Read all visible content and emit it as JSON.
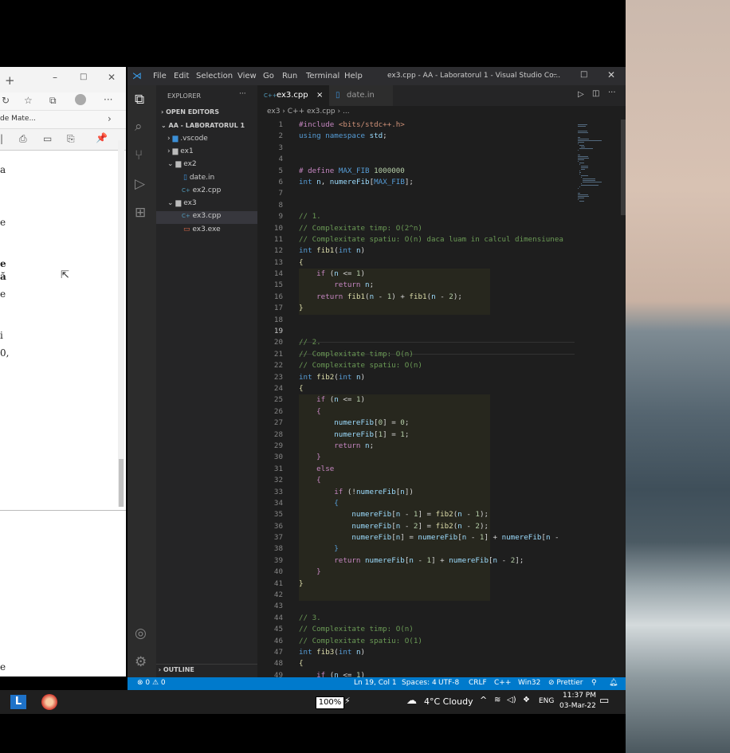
{
  "browser": {
    "tab_label": "de Mate...",
    "body_letters": [
      "a",
      "e",
      "e",
      "ă",
      "e",
      "i",
      "0,",
      "e"
    ]
  },
  "vscode": {
    "menu": [
      "File",
      "Edit",
      "Selection",
      "View",
      "Go",
      "Run",
      "Terminal",
      "Help"
    ],
    "title": "ex3.cpp - AA - Laboratorul 1 - Visual Studio Co...",
    "explorer_label": "EXPLORER",
    "open_editors": "OPEN EDITORS",
    "project": "AA - LABORATORUL 1",
    "tree": [
      {
        "label": ".vscode",
        "icon": "folder-icon"
      },
      {
        "label": "ex1",
        "icon": "folder-icon"
      },
      {
        "label": "ex2",
        "icon": "folder-open-icon"
      },
      {
        "label": "date.in",
        "icon": "file-icon"
      },
      {
        "label": "ex2.cpp",
        "icon": "cpp-file-icon"
      },
      {
        "label": "ex3",
        "icon": "folder-open-icon"
      },
      {
        "label": "ex3.cpp",
        "icon": "cpp-file-icon"
      },
      {
        "label": "ex3.exe",
        "icon": "exe-file-icon"
      }
    ],
    "outline_label": "OUTLINE",
    "tabs": [
      {
        "label": "ex3.cpp",
        "prefix": "C++",
        "close": "×"
      },
      {
        "label": "date.in"
      }
    ],
    "breadcrumb": "ex3 › C++ ex3.cpp › ...",
    "status": {
      "left": "⊗ 0 ⚠ 0",
      "position": "Ln 19, Col 1",
      "spaces": "Spaces: 4",
      "encoding": "UTF-8",
      "eol": "CRLF",
      "lang": "C++",
      "platform": "Win32",
      "prettier": "⊘ Prettier"
    },
    "current_line": 19,
    "code": [
      "<span class=\"pp\">#include</span> <span class=\"st2\">&lt;bits/stdc++.h&gt;</span>",
      "<span class=\"kw\">using</span> <span class=\"kw\">namespace</span> <span class=\"vr\">std</span>;",
      "",
      "",
      "<span class=\"pp\"># define</span> <span class=\"mac\">MAX_FIB</span> <span class=\"nu\">1000000</span>",
      "<span class=\"ty\">int</span> <span class=\"vr\">n</span>, <span class=\"vr\">numereFib</span>[<span class=\"mac\">MAX_FIB</span>];",
      "",
      "",
      "<span class=\"cm\">// 1.</span>",
      "<span class=\"cm\">// Complexitate timp: O(2^n)</span>",
      "<span class=\"cm\">// Complexitate spatiu: O(n) daca luam in calcul dimensiunea</span>",
      "<span class=\"ty\">int</span> <span class=\"fn\">fib1</span>(<span class=\"ty\">int</span> <span class=\"vr\">n</span>)",
      "<span class=\"fn\">{</span>",
      "    <span class=\"ctl\">if</span> (<span class=\"vr\">n</span> &lt;= <span class=\"nu\">1</span>)",
      "        <span class=\"ctl\">return</span> <span class=\"vr\">n</span>;",
      "    <span class=\"ctl\">return</span> <span class=\"fn\">fib1</span>(<span class=\"vr\">n</span> - <span class=\"nu\">1</span>) + <span class=\"fn\">fib1</span>(<span class=\"vr\">n</span> - <span class=\"nu\">2</span>);",
      "<span class=\"fn\">}</span>",
      "",
      "",
      "<span class=\"cm\">// 2.</span>",
      "<span class=\"cm\">// Complexitate timp: O(n)</span>",
      "<span class=\"cm\">// Complexitate spatiu: O(n)</span>",
      "<span class=\"ty\">int</span> <span class=\"fn\">fib2</span>(<span class=\"ty\">int</span> <span class=\"vr\">n</span>)",
      "<span class=\"fn\">{</span>",
      "    <span class=\"ctl\">if</span> (<span class=\"vr\">n</span> &lt;= <span class=\"nu\">1</span>)",
      "    <span class=\"ctl\">{</span>",
      "        <span class=\"vr\">numereFib</span>[<span class=\"nu\">0</span>] = <span class=\"nu\">0</span>;",
      "        <span class=\"vr\">numereFib</span>[<span class=\"nu\">1</span>] = <span class=\"nu\">1</span>;",
      "        <span class=\"ctl\">return</span> <span class=\"vr\">n</span>;",
      "    <span class=\"ctl\">}</span>",
      "    <span class=\"ctl\">else</span>",
      "    <span class=\"ctl\">{</span>",
      "        <span class=\"ctl\">if</span> (!<span class=\"vr\">numereFib</span>[<span class=\"vr\">n</span>])",
      "        <span class=\"kw\">{</span>",
      "            <span class=\"vr\">numereFib</span>[<span class=\"vr\">n</span> - <span class=\"nu\">1</span>] = <span class=\"fn\">fib2</span>(<span class=\"vr\">n</span> - <span class=\"nu\">1</span>);",
      "            <span class=\"vr\">numereFib</span>[<span class=\"vr\">n</span> - <span class=\"nu\">2</span>] = <span class=\"fn\">fib2</span>(<span class=\"vr\">n</span> - <span class=\"nu\">2</span>);",
      "            <span class=\"vr\">numereFib</span>[<span class=\"vr\">n</span>] = <span class=\"vr\">numereFib</span>[<span class=\"vr\">n</span> - <span class=\"nu\">1</span>] + <span class=\"vr\">numereFib</span>[<span class=\"vr\">n</span> -",
      "        <span class=\"kw\">}</span>",
      "        <span class=\"ctl\">return</span> <span class=\"vr\">numereFib</span>[<span class=\"vr\">n</span> - <span class=\"nu\">1</span>] + <span class=\"vr\">numereFib</span>[<span class=\"vr\">n</span> - <span class=\"nu\">2</span>];",
      "    <span class=\"ctl\">}</span>",
      "<span class=\"fn\">}</span>",
      "",
      "",
      "<span class=\"cm\">// 3.</span>",
      "<span class=\"cm\">// Complexitate timp: O(n)</span>",
      "<span class=\"cm\">// Complexitate spatiu: O(1)</span>",
      "<span class=\"ty\">int</span> <span class=\"fn\">fib3</span>(<span class=\"ty\">int</span> <span class=\"vr\">n</span>)",
      "<span class=\"fn\">{</span>",
      "    <span class=\"ctl\">if</span> (<span class=\"vr\">n</span> &lt;= <span class=\"nu\">1</span>)"
    ]
  },
  "taskbar": {
    "battery": "100%",
    "weather": "4°C  Cloudy",
    "lang": "ENG",
    "time": "11:37 PM",
    "date": "03-Mar-22"
  },
  "colors": {
    "statusbar": "#007acc",
    "editor_bg": "#1e1e1e",
    "sidebar_bg": "#252526"
  }
}
